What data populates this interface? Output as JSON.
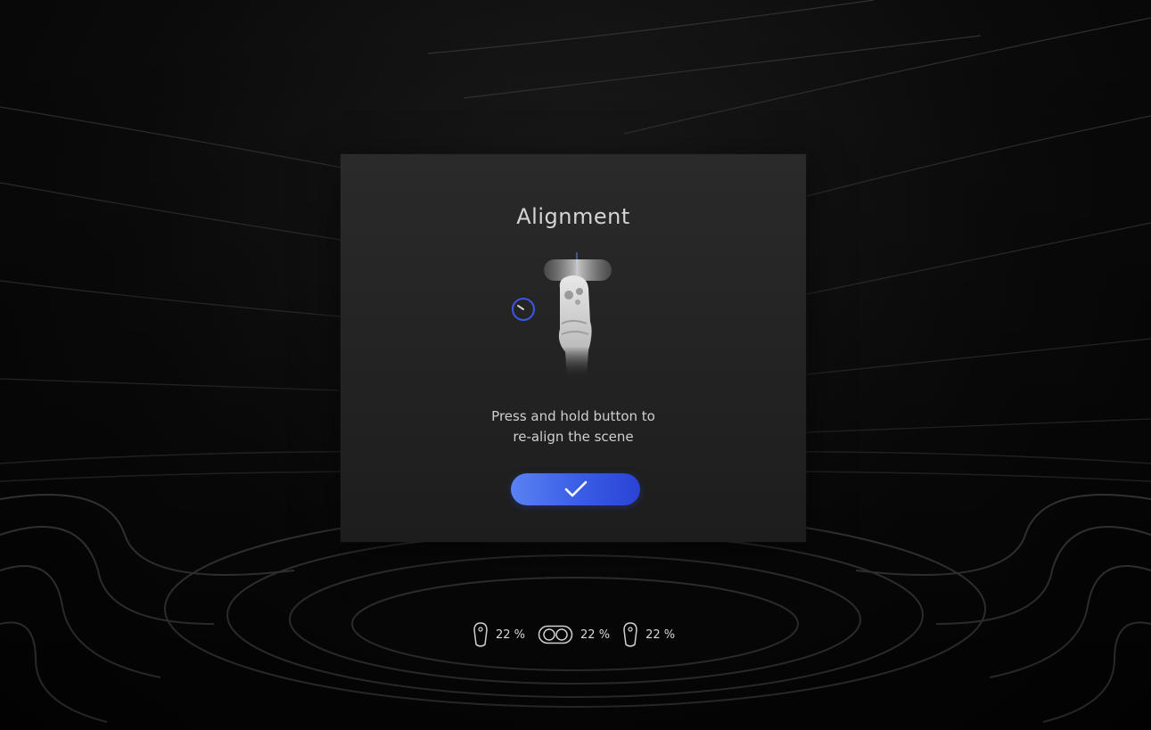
{
  "dialog": {
    "title": "Alignment",
    "instruction_line1": "Press and hold button to",
    "instruction_line2": "re-align the scene",
    "confirm_icon": "checkmark-icon",
    "progress_icon": "progress-ring-icon",
    "illustration": "hand-holding-controller"
  },
  "status": {
    "left_controller": {
      "icon": "controller-icon",
      "label": "22 %",
      "percent": 22
    },
    "headset": {
      "icon": "headset-icon",
      "label": "22 %",
      "percent": 22
    },
    "right_controller": {
      "icon": "controller-icon",
      "label": "22 %",
      "percent": 22
    }
  },
  "colors": {
    "accent_start": "#5a82f2",
    "accent_end": "#2a43d6",
    "progress_ring": "#3e56e8",
    "panel": "#242424",
    "text": "#d4d4d4"
  }
}
